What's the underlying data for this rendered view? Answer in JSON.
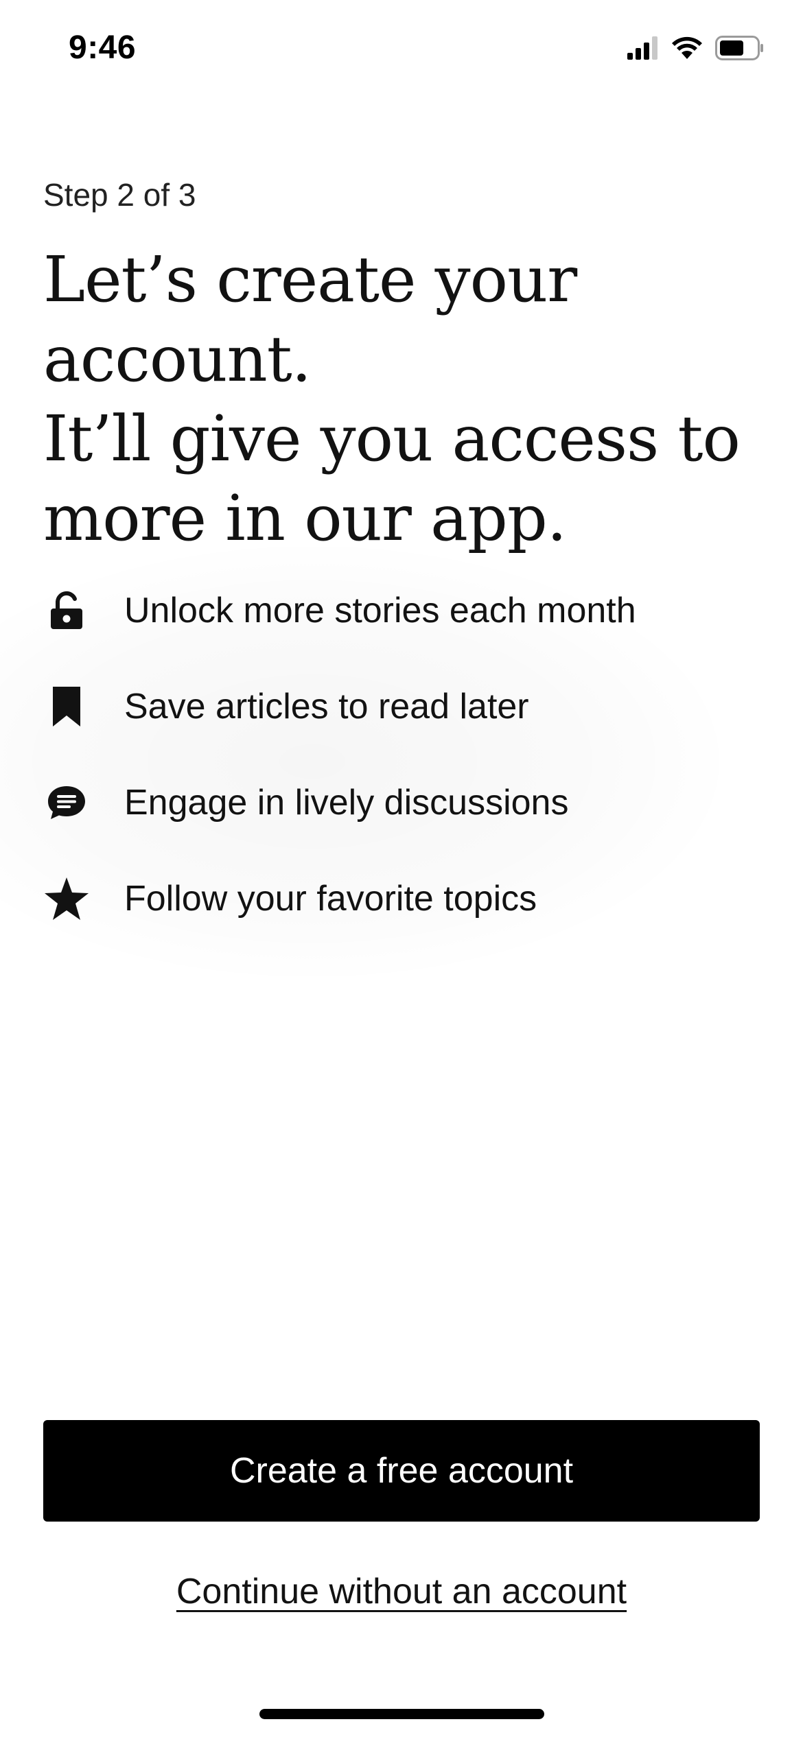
{
  "status_bar": {
    "time": "9:46",
    "icons": [
      "cellular-signal-icon",
      "wifi-icon",
      "battery-icon"
    ]
  },
  "onboarding": {
    "step": "Step 2 of 3",
    "headline_lines": [
      "Let’s create your account.",
      "It’ll give you access to",
      "more in our app."
    ],
    "benefits": [
      {
        "icon": "unlock-icon",
        "label": "Unlock more stories each month"
      },
      {
        "icon": "bookmark-icon",
        "label": "Save articles to read later"
      },
      {
        "icon": "chat-bubble-icon",
        "label": "Engage in lively discussions"
      },
      {
        "icon": "star-icon",
        "label": "Follow your favorite topics"
      }
    ],
    "primary_button": "Create a free account",
    "secondary_link": "Continue without an account"
  },
  "colors": {
    "text": "#121212",
    "button_background": "#000000",
    "button_text": "#ffffff",
    "background": "#ffffff"
  }
}
